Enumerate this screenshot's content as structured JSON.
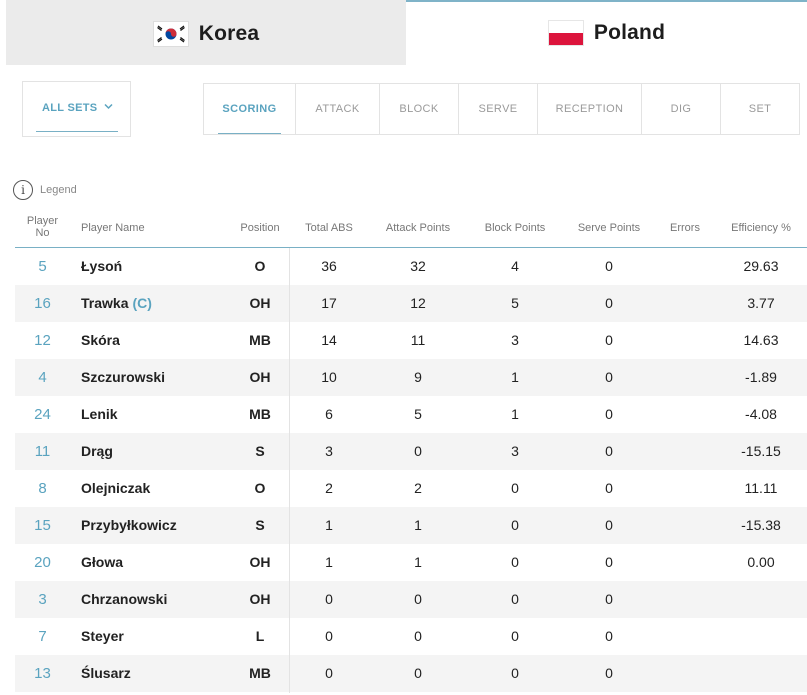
{
  "teams": {
    "home": {
      "name": "Korea",
      "flag_icon": "korea-flag-icon"
    },
    "away": {
      "name": "Poland",
      "flag_icon": "poland-flag-icon"
    }
  },
  "set_selector": {
    "label": "ALL SETS",
    "icon": "chevron-down-icon"
  },
  "stat_tabs": [
    {
      "label": "SCORING",
      "active": true
    },
    {
      "label": "ATTACK",
      "active": false
    },
    {
      "label": "BLOCK",
      "active": false
    },
    {
      "label": "SERVE",
      "active": false
    },
    {
      "label": "RECEPTION",
      "active": false
    },
    {
      "label": "DIG",
      "active": false
    },
    {
      "label": "SET",
      "active": false
    }
  ],
  "legend": {
    "label": "Legend",
    "icon": "info-icon"
  },
  "columns": {
    "player_no": "Player No",
    "player_name": "Player Name",
    "position": "Position",
    "total_abs": "Total ABS",
    "attack_points": "Attack Points",
    "block_points": "Block Points",
    "serve_points": "Serve Points",
    "errors": "Errors",
    "efficiency": "Efficiency %"
  },
  "rows": [
    {
      "no": "5",
      "name": "Łysoń",
      "captain": "",
      "pos": "O",
      "abs": "36",
      "att": "32",
      "blk": "4",
      "srv": "0",
      "err": "",
      "eff": "29.63"
    },
    {
      "no": "16",
      "name": "Trawka",
      "captain": "(C)",
      "pos": "OH",
      "abs": "17",
      "att": "12",
      "blk": "5",
      "srv": "0",
      "err": "",
      "eff": "3.77"
    },
    {
      "no": "12",
      "name": "Skóra",
      "captain": "",
      "pos": "MB",
      "abs": "14",
      "att": "11",
      "blk": "3",
      "srv": "0",
      "err": "",
      "eff": "14.63"
    },
    {
      "no": "4",
      "name": "Szczurowski",
      "captain": "",
      "pos": "OH",
      "abs": "10",
      "att": "9",
      "blk": "1",
      "srv": "0",
      "err": "",
      "eff": "-1.89"
    },
    {
      "no": "24",
      "name": "Lenik",
      "captain": "",
      "pos": "MB",
      "abs": "6",
      "att": "5",
      "blk": "1",
      "srv": "0",
      "err": "",
      "eff": "-4.08"
    },
    {
      "no": "11",
      "name": "Drąg",
      "captain": "",
      "pos": "S",
      "abs": "3",
      "att": "0",
      "blk": "3",
      "srv": "0",
      "err": "",
      "eff": "-15.15"
    },
    {
      "no": "8",
      "name": "Olejniczak",
      "captain": "",
      "pos": "O",
      "abs": "2",
      "att": "2",
      "blk": "0",
      "srv": "0",
      "err": "",
      "eff": "11.11"
    },
    {
      "no": "15",
      "name": "Przybyłkowicz",
      "captain": "",
      "pos": "S",
      "abs": "1",
      "att": "1",
      "blk": "0",
      "srv": "0",
      "err": "",
      "eff": "-15.38"
    },
    {
      "no": "20",
      "name": "Głowa",
      "captain": "",
      "pos": "OH",
      "abs": "1",
      "att": "1",
      "blk": "0",
      "srv": "0",
      "err": "",
      "eff": "0.00"
    },
    {
      "no": "3",
      "name": "Chrzanowski",
      "captain": "",
      "pos": "OH",
      "abs": "0",
      "att": "0",
      "blk": "0",
      "srv": "0",
      "err": "",
      "eff": ""
    },
    {
      "no": "7",
      "name": "Steyer",
      "captain": "",
      "pos": "L",
      "abs": "0",
      "att": "0",
      "blk": "0",
      "srv": "0",
      "err": "",
      "eff": ""
    },
    {
      "no": "13",
      "name": "Ślusarz",
      "captain": "",
      "pos": "MB",
      "abs": "0",
      "att": "0",
      "blk": "0",
      "srv": "0",
      "err": "",
      "eff": ""
    }
  ],
  "colors": {
    "accent": "#5aa3bf",
    "korea_red": "#cd2e3a",
    "korea_blue": "#0047a0",
    "poland_red": "#dc143c"
  }
}
